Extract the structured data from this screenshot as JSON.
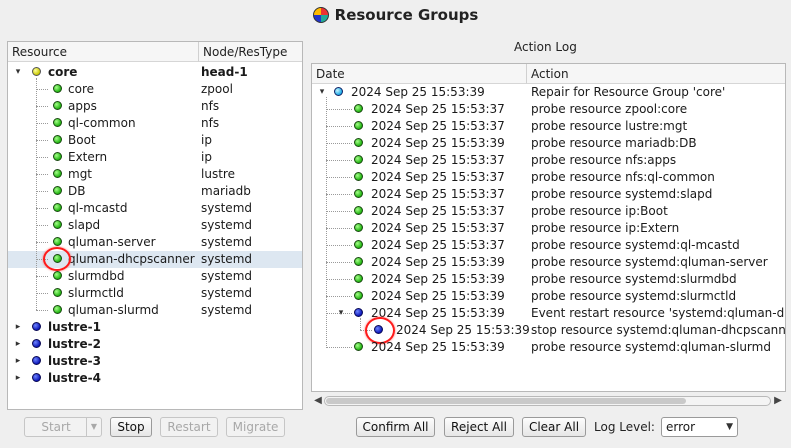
{
  "window": {
    "title": "Resource Groups",
    "icon": "app-globe-icon"
  },
  "resource_tree": {
    "columns": {
      "resource": "Resource",
      "node": "Node/ResType"
    },
    "groups": [
      {
        "name": "core",
        "node": "head-1",
        "state": "expanded",
        "status": "yellow",
        "children": [
          {
            "name": "core",
            "type": "zpool",
            "status": "green"
          },
          {
            "name": "apps",
            "type": "nfs",
            "status": "green"
          },
          {
            "name": "ql-common",
            "type": "nfs",
            "status": "green"
          },
          {
            "name": "Boot",
            "type": "ip",
            "status": "green"
          },
          {
            "name": "Extern",
            "type": "ip",
            "status": "green"
          },
          {
            "name": "mgt",
            "type": "lustre",
            "status": "green"
          },
          {
            "name": "DB",
            "type": "mariadb",
            "status": "green"
          },
          {
            "name": "ql-mcastd",
            "type": "systemd",
            "status": "green"
          },
          {
            "name": "slapd",
            "type": "systemd",
            "status": "green"
          },
          {
            "name": "qluman-server",
            "type": "systemd",
            "status": "green"
          },
          {
            "name": "qluman-dhcpscanner",
            "type": "systemd",
            "status": "green",
            "selected": true,
            "marked": true
          },
          {
            "name": "slurmdbd",
            "type": "systemd",
            "status": "green"
          },
          {
            "name": "slurmctld",
            "type": "systemd",
            "status": "green"
          },
          {
            "name": "qluman-slurmd",
            "type": "systemd",
            "status": "green"
          }
        ]
      },
      {
        "name": "lustre-1",
        "node": "",
        "state": "collapsed",
        "status": "blue"
      },
      {
        "name": "lustre-2",
        "node": "",
        "state": "collapsed",
        "status": "blue"
      },
      {
        "name": "lustre-3",
        "node": "",
        "state": "collapsed",
        "status": "blue"
      },
      {
        "name": "lustre-4",
        "node": "",
        "state": "collapsed",
        "status": "blue"
      }
    ]
  },
  "action_log": {
    "label": "Action Log",
    "columns": {
      "date": "Date",
      "action": "Action"
    },
    "entries": [
      {
        "date": "2024 Sep 25 15:53:39",
        "action": "Repair for Resource Group 'core'",
        "level": 0,
        "status": "cyan",
        "expanded": true
      },
      {
        "date": "2024 Sep 25 15:53:37",
        "action": "probe resource zpool:core",
        "level": 1,
        "status": "green"
      },
      {
        "date": "2024 Sep 25 15:53:37",
        "action": "probe resource lustre:mgt",
        "level": 1,
        "status": "green"
      },
      {
        "date": "2024 Sep 25 15:53:39",
        "action": "probe resource mariadb:DB",
        "level": 1,
        "status": "green"
      },
      {
        "date": "2024 Sep 25 15:53:37",
        "action": "probe resource nfs:apps",
        "level": 1,
        "status": "green"
      },
      {
        "date": "2024 Sep 25 15:53:37",
        "action": "probe resource nfs:ql-common",
        "level": 1,
        "status": "green"
      },
      {
        "date": "2024 Sep 25 15:53:37",
        "action": "probe resource systemd:slapd",
        "level": 1,
        "status": "green"
      },
      {
        "date": "2024 Sep 25 15:53:37",
        "action": "probe resource ip:Boot",
        "level": 1,
        "status": "green"
      },
      {
        "date": "2024 Sep 25 15:53:37",
        "action": "probe resource ip:Extern",
        "level": 1,
        "status": "green"
      },
      {
        "date": "2024 Sep 25 15:53:37",
        "action": "probe resource systemd:ql-mcastd",
        "level": 1,
        "status": "green"
      },
      {
        "date": "2024 Sep 25 15:53:39",
        "action": "probe resource systemd:qluman-server",
        "level": 1,
        "status": "green"
      },
      {
        "date": "2024 Sep 25 15:53:39",
        "action": "probe resource systemd:slurmdbd",
        "level": 1,
        "status": "green"
      },
      {
        "date": "2024 Sep 25 15:53:39",
        "action": "probe resource systemd:slurmctld",
        "level": 1,
        "status": "green"
      },
      {
        "date": "2024 Sep 25 15:53:39",
        "action": "Event restart resource 'systemd:qluman-d",
        "level": 1,
        "status": "blue",
        "expanded": true
      },
      {
        "date": "2024 Sep 25 15:53:39",
        "action": "stop resource systemd:qluman-dhcpscann",
        "level": 2,
        "status": "blue",
        "marked": true
      },
      {
        "date": "2024 Sep 25 15:53:39",
        "action": "probe resource systemd:qluman-slurmd",
        "level": 1,
        "status": "green"
      }
    ]
  },
  "left_buttons": {
    "start": "Start",
    "stop": "Stop",
    "restart": "Restart",
    "migrate": "Migrate"
  },
  "right_buttons": {
    "confirm_all": "Confirm All",
    "reject_all": "Reject All",
    "clear_all": "Clear All"
  },
  "log_level": {
    "label": "Log Level:",
    "value": "error"
  },
  "colors": {
    "green": "#20b410",
    "blue": "#0b16b8",
    "yellow": "#c8c800",
    "cyan": "#1aa8e6",
    "selection": "#dde7f1",
    "marker": "#ff1a1a"
  }
}
